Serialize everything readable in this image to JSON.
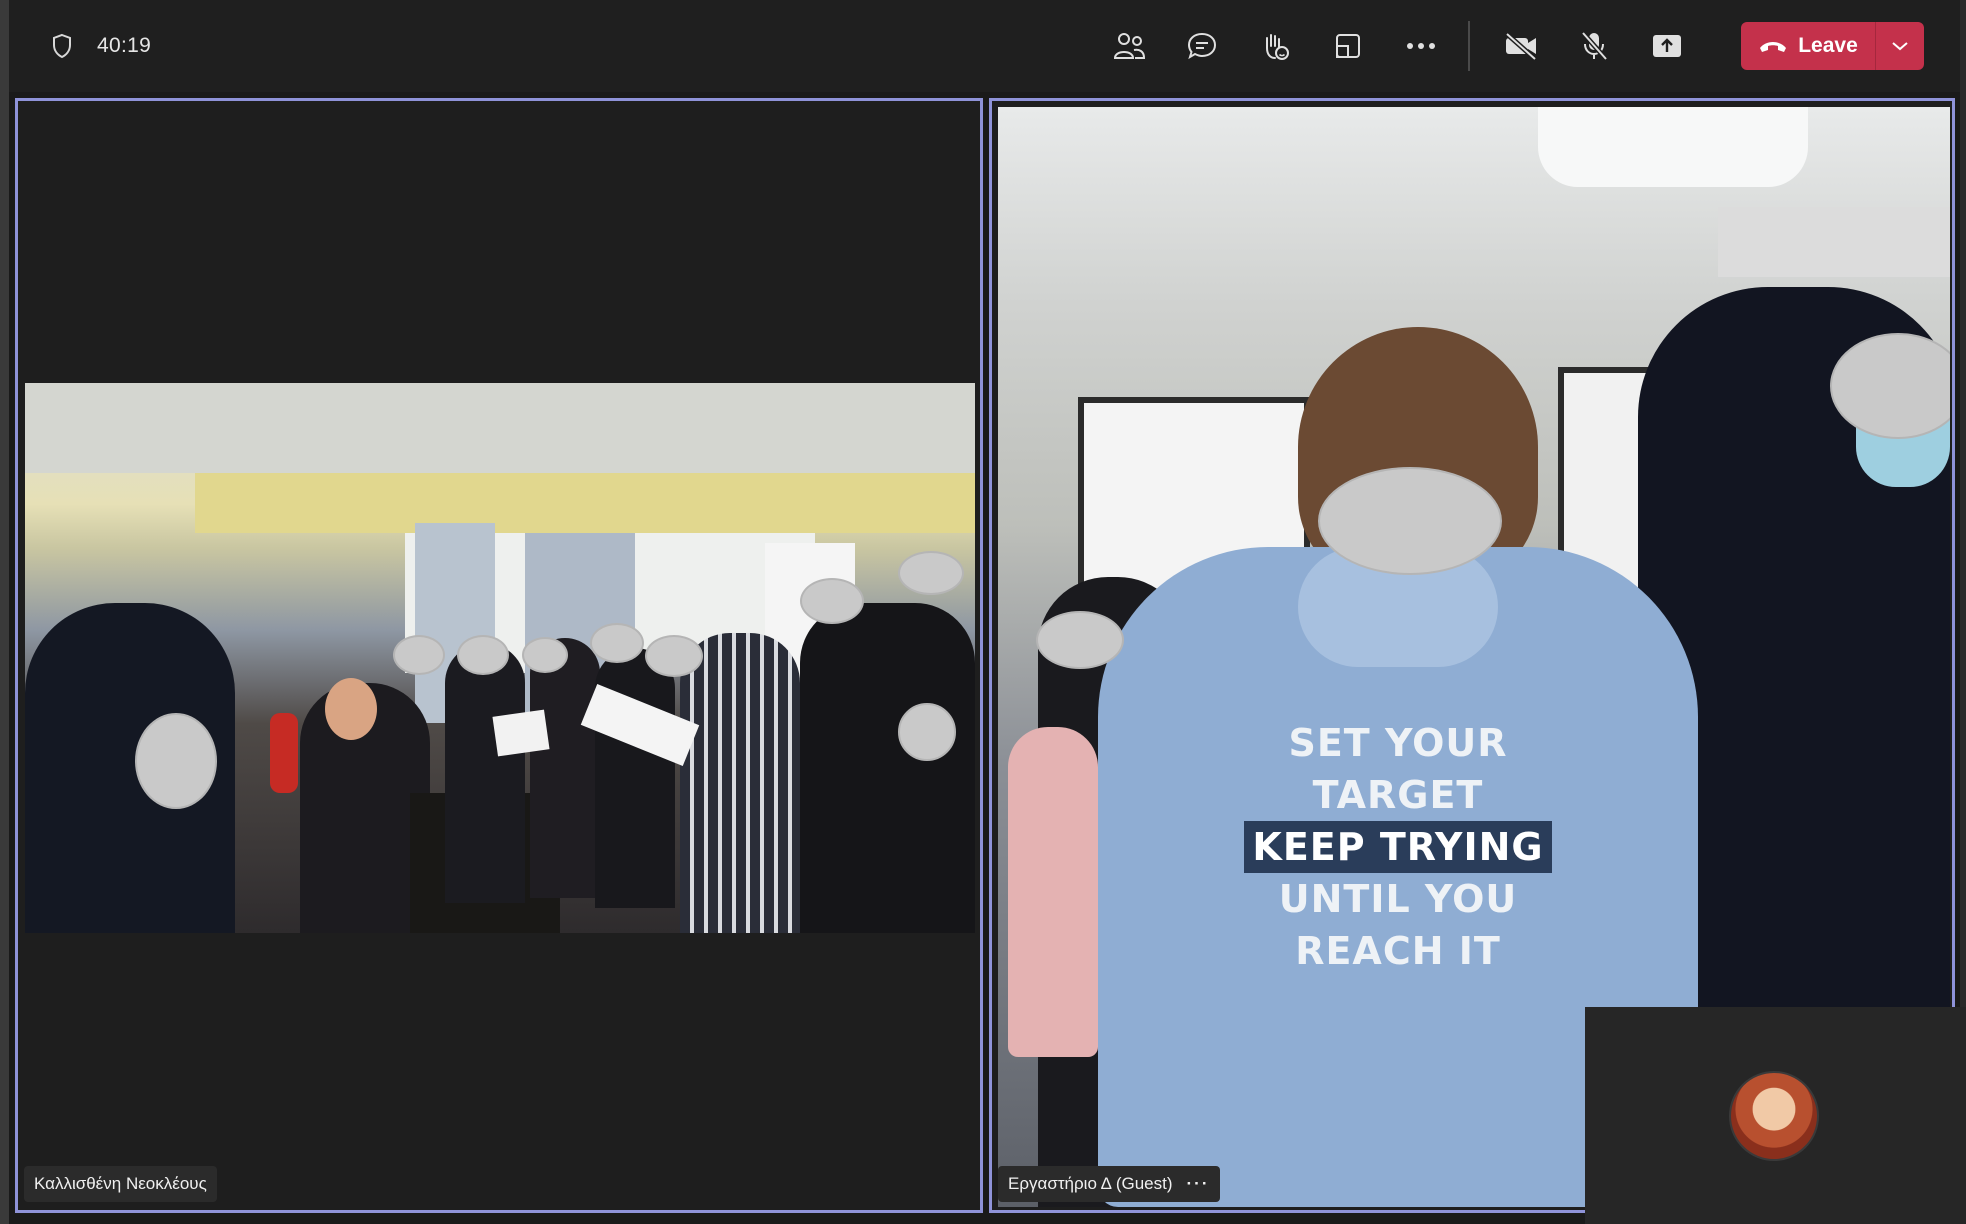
{
  "meeting": {
    "timer": "40:19"
  },
  "toolbar": {
    "buttons": [
      {
        "name": "people-icon"
      },
      {
        "name": "chat-icon"
      },
      {
        "name": "reactions-icon"
      },
      {
        "name": "rooms-icon"
      },
      {
        "name": "more-icon"
      }
    ],
    "media": [
      {
        "name": "camera-off-icon"
      },
      {
        "name": "mic-off-icon"
      },
      {
        "name": "share-icon"
      }
    ],
    "leave_label": "Leave"
  },
  "tiles": {
    "left": {
      "participant_name": "Καλλισθένη Νεοκλέους"
    },
    "right": {
      "participant_name": "Εργαστήριο Δ (Guest)",
      "more_label": "···",
      "hoodie_lines": [
        "SET YOUR",
        "TARGET",
        "KEEP TRYING",
        "UNTIL YOU",
        "REACH IT"
      ]
    }
  },
  "colors": {
    "leave": "#c4314b",
    "tile_border": "#8f93d9",
    "bar": "#1f1f1f"
  }
}
